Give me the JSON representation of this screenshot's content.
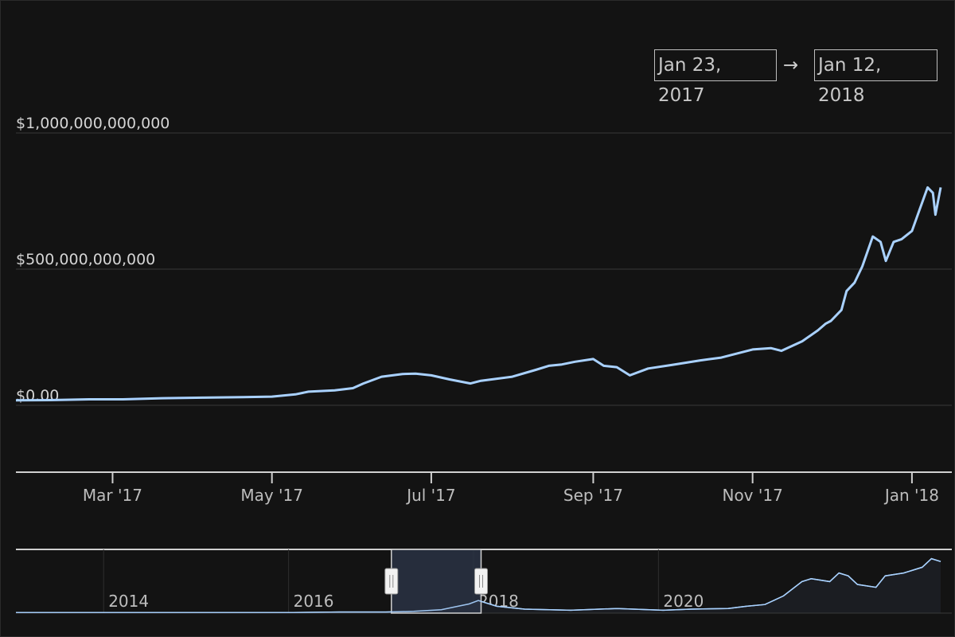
{
  "range_selector": {
    "from": "Jan 23, 2017",
    "arrow": "→",
    "to": "Jan 12, 2018"
  },
  "colors": {
    "background": "#131313",
    "line": "#a9d1ff",
    "volume": "#7d7d7d",
    "grid": "#3a3a3a",
    "navigator_window": "#2a3344"
  },
  "chart_data": [
    {
      "type": "line",
      "title": "",
      "xlabel": "",
      "ylabel": "",
      "x_range": [
        "2017-01-23",
        "2018-01-12"
      ],
      "ylim": [
        0,
        1000000000000
      ],
      "y_ticks": [
        {
          "value": 0,
          "label": "$0.00"
        },
        {
          "value": 500000000000,
          "label": "$500,000,000,000"
        },
        {
          "value": 1000000000000,
          "label": "$1,000,000,000,000"
        }
      ],
      "x_ticks": [
        {
          "date": "2017-03-01",
          "label": "Mar '17"
        },
        {
          "date": "2017-05-01",
          "label": "May '17"
        },
        {
          "date": "2017-07-01",
          "label": "Jul '17"
        },
        {
          "date": "2017-09-01",
          "label": "Sep '17"
        },
        {
          "date": "2017-11-01",
          "label": "Nov '17"
        },
        {
          "date": "2018-01-01",
          "label": "Jan '18"
        }
      ],
      "grid": true,
      "series": [
        {
          "x": [
            "2017-01-23",
            "2017-02-05",
            "2017-02-20",
            "2017-03-05",
            "2017-03-20",
            "2017-04-05",
            "2017-04-20",
            "2017-05-01",
            "2017-05-10",
            "2017-05-15",
            "2017-05-25",
            "2017-06-01",
            "2017-06-05",
            "2017-06-12",
            "2017-06-20",
            "2017-06-25",
            "2017-07-01",
            "2017-07-08",
            "2017-07-16",
            "2017-07-20",
            "2017-08-01",
            "2017-08-10",
            "2017-08-15",
            "2017-08-20",
            "2017-08-25",
            "2017-09-01",
            "2017-09-05",
            "2017-09-10",
            "2017-09-15",
            "2017-09-22",
            "2017-10-01",
            "2017-10-12",
            "2017-10-20",
            "2017-11-01",
            "2017-11-08",
            "2017-11-12",
            "2017-11-20",
            "2017-11-26",
            "2017-11-29",
            "2017-12-01",
            "2017-12-05",
            "2017-12-07",
            "2017-12-10",
            "2017-12-13",
            "2017-12-17",
            "2017-12-20",
            "2017-12-22",
            "2017-12-25",
            "2017-12-28",
            "2018-01-01",
            "2018-01-04",
            "2018-01-07",
            "2018-01-09",
            "2018-01-10",
            "2018-01-12"
          ],
          "values": [
            18000000000,
            19000000000,
            22000000000,
            22000000000,
            26000000000,
            28000000000,
            30000000000,
            32000000000,
            40000000000,
            50000000000,
            55000000000,
            63000000000,
            80000000000,
            105000000000,
            115000000000,
            116000000000,
            110000000000,
            95000000000,
            80000000000,
            90000000000,
            105000000000,
            130000000000,
            145000000000,
            150000000000,
            160000000000,
            170000000000,
            145000000000,
            140000000000,
            110000000000,
            135000000000,
            148000000000,
            165000000000,
            175000000000,
            205000000000,
            210000000000,
            200000000000,
            235000000000,
            275000000000,
            300000000000,
            310000000000,
            350000000000,
            420000000000,
            450000000000,
            510000000000,
            620000000000,
            600000000000,
            530000000000,
            600000000000,
            610000000000,
            640000000000,
            720000000000,
            800000000000,
            780000000000,
            700000000000,
            800000000000
          ]
        }
      ]
    },
    {
      "type": "bar",
      "title": "",
      "xlabel": "",
      "ylabel": "",
      "note_series": "volume",
      "x_range": [
        "2017-01-23",
        "2018-01-12"
      ],
      "values": [
        0,
        0,
        0,
        0,
        0,
        0,
        0,
        0,
        0,
        0,
        0,
        0,
        0,
        0,
        0,
        0,
        0,
        0,
        0,
        0,
        0,
        0,
        0,
        0,
        0,
        0,
        0,
        0,
        0,
        0,
        0,
        0,
        0,
        0,
        0,
        0,
        0,
        0,
        0,
        0,
        0,
        0,
        0,
        0,
        0,
        0,
        0,
        0,
        0,
        0,
        0,
        0,
        0,
        0,
        0,
        0,
        0,
        0,
        0,
        0,
        0,
        0,
        0,
        0,
        0,
        0,
        0,
        0,
        0,
        0,
        0,
        0,
        0,
        0,
        0,
        0,
        0,
        0,
        0,
        0,
        0,
        0,
        0,
        0,
        0,
        0,
        0,
        0,
        0,
        0,
        0,
        0,
        0,
        0,
        0,
        0,
        0,
        0,
        0,
        0,
        0,
        0,
        0,
        0,
        0,
        0,
        0,
        0,
        0,
        0,
        0,
        0,
        0,
        0,
        0,
        0,
        0,
        0,
        0,
        0,
        0,
        0,
        0,
        0,
        0,
        0,
        0,
        0,
        0,
        0,
        0,
        0,
        0,
        0,
        0,
        0,
        0,
        0,
        0,
        0,
        0,
        0,
        0,
        0,
        0,
        0,
        0,
        0,
        0,
        0,
        0,
        0,
        0,
        0,
        0,
        0,
        0,
        0,
        0,
        0,
        0,
        0,
        0,
        0,
        0,
        0,
        0,
        0,
        0,
        0,
        0,
        0,
        0,
        0,
        0,
        0,
        0,
        0,
        0,
        0,
        0,
        0,
        0,
        0,
        0,
        0,
        0,
        0,
        0,
        0,
        0,
        0,
        0,
        0,
        0,
        0,
        0,
        0,
        0,
        0,
        0,
        0,
        0,
        0,
        0,
        0,
        0,
        0,
        0,
        0,
        0,
        0,
        0,
        0,
        0,
        0,
        0,
        0,
        0,
        0,
        0,
        0,
        0,
        0,
        0,
        0,
        0,
        0,
        0,
        0,
        0,
        0,
        0,
        0,
        0,
        0,
        0,
        0,
        0,
        0,
        0,
        0,
        0,
        0,
        0,
        0,
        0,
        0,
        0,
        0,
        0,
        0,
        0,
        0,
        0,
        0,
        0,
        0,
        0,
        0,
        0,
        0,
        0,
        0,
        0,
        0,
        0,
        0,
        0,
        0,
        0,
        0,
        0,
        0,
        0,
        0,
        0,
        0,
        0,
        0,
        0,
        0,
        0,
        0,
        0,
        0,
        0,
        0,
        0,
        0,
        0,
        0,
        0,
        0,
        0,
        0,
        0,
        0,
        0,
        0,
        0,
        0,
        0,
        0,
        0,
        0,
        0,
        0,
        0,
        0,
        0,
        0,
        0,
        0,
        0,
        0,
        0,
        0,
        0,
        0,
        0,
        0,
        0,
        0,
        0,
        0,
        0,
        0,
        0,
        0,
        0,
        0,
        0,
        0,
        0,
        0,
        0,
        0,
        0,
        0,
        0,
        0,
        0,
        0,
        0,
        0,
        0,
        0,
        0,
        0,
        0,
        0
      ]
    },
    {
      "type": "area",
      "title": "",
      "xlabel": "",
      "ylabel": "",
      "x_ticks": [
        "2014",
        "2016",
        "2018",
        "2020"
      ],
      "selected_window": [
        "2017-01-23",
        "2018-01-12"
      ],
      "series": [
        {
          "x": [
            2013.0,
            2014.0,
            2015.0,
            2016.0,
            2016.5,
            2017.0,
            2017.3,
            2017.6,
            2017.9,
            2018.0,
            2018.2,
            2018.5,
            2019.0,
            2019.5,
            2020.0,
            2020.3,
            2020.7,
            2020.9,
            2021.1,
            2021.3,
            2021.5,
            2021.6,
            2021.8,
            2021.9,
            2022.0,
            2022.1,
            2022.3,
            2022.4,
            2022.6,
            2022.8,
            2022.9,
            2023.0
          ],
          "values": [
            0.01,
            0.01,
            0.01,
            0.01,
            0.02,
            0.02,
            0.03,
            0.06,
            0.16,
            0.22,
            0.12,
            0.07,
            0.05,
            0.08,
            0.05,
            0.07,
            0.08,
            0.12,
            0.15,
            0.3,
            0.55,
            0.6,
            0.55,
            0.7,
            0.65,
            0.5,
            0.45,
            0.65,
            0.7,
            0.8,
            0.95,
            0.9
          ]
        }
      ]
    }
  ]
}
